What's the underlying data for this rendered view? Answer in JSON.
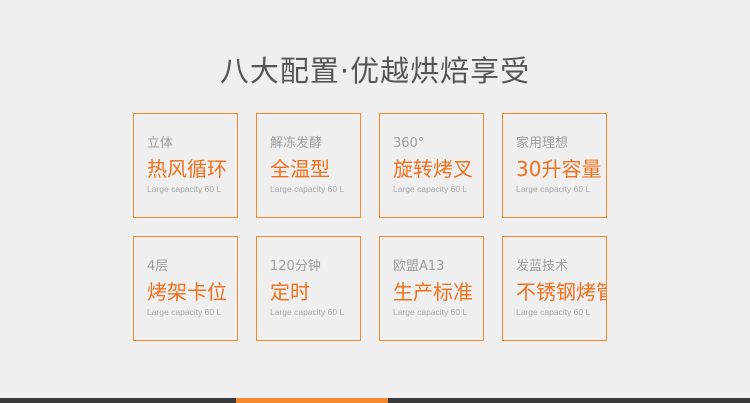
{
  "title": "八大配置·优越烘焙享受",
  "features": [
    {
      "sub": "立体",
      "main": "热风循环",
      "cap": "Large capacity 60 L"
    },
    {
      "sub": "解冻发酵",
      "main": "全温型",
      "cap": "Large capacity 60 L"
    },
    {
      "sub": "360°",
      "main": "旋转烤叉",
      "cap": "Large capacity 60 L"
    },
    {
      "sub": "家用理想",
      "main": "30升容量",
      "cap": "Large capacity 60 L"
    },
    {
      "sub": "4层",
      "main": "烤架卡位",
      "cap": "Large capacity 60 L"
    },
    {
      "sub": "120分钟",
      "main": "定时",
      "cap": "Large capacity 60 L"
    },
    {
      "sub": "欧盟A13",
      "main": "生产标准",
      "cap": "Large capacity 60 L"
    },
    {
      "sub": "发蓝技术",
      "main": "不锈钢烤管",
      "cap": "Large capacity 60 L"
    }
  ],
  "colors": {
    "accent": "#f4892f",
    "accent_text": "#f2701d",
    "background": "#efefef",
    "bottom_bar": "#3a3a3a"
  }
}
